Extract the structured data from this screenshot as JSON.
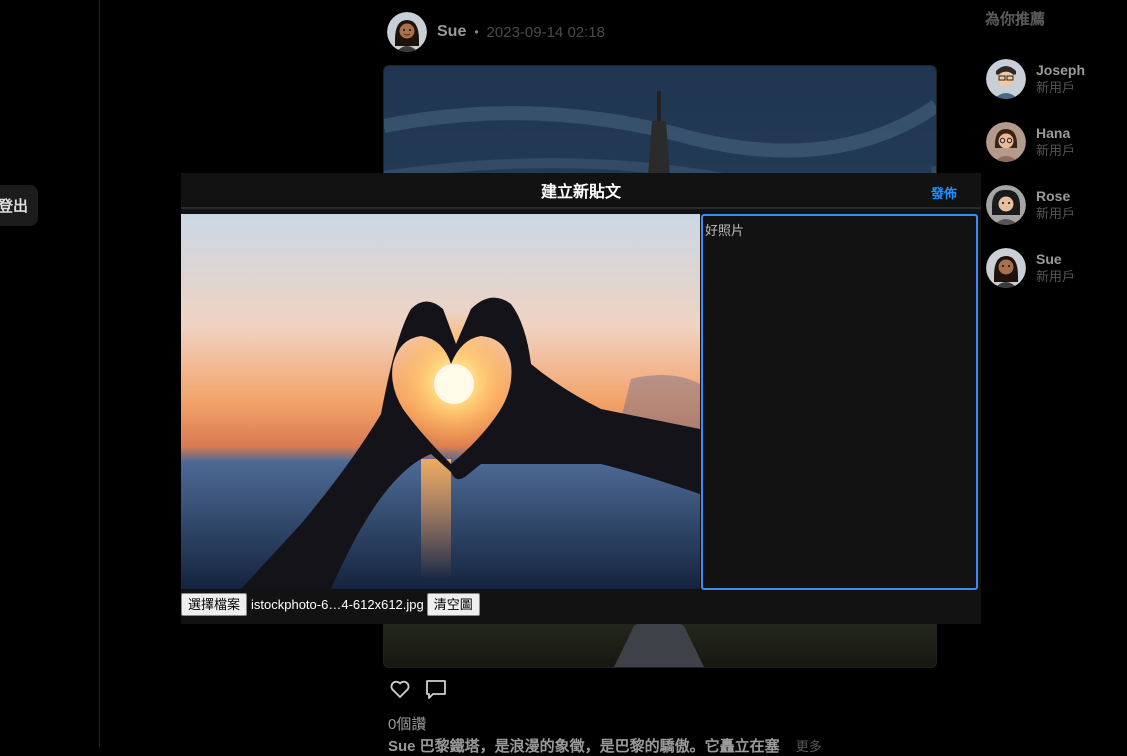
{
  "sidebar": {
    "logout_label": "登出"
  },
  "post": {
    "author": "Sue",
    "dot": "•",
    "time": "2023-09-14 02:18",
    "likes_text": "0個讚",
    "caption_text": "Sue 巴黎鐵塔，是浪漫的象徵，是巴黎的驕傲。它矗立在塞",
    "more_label": "更多"
  },
  "suggestions": {
    "title": "為你推薦",
    "items": [
      {
        "name": "Joseph",
        "subtitle": "新用戶",
        "skin": "#f1c9a5",
        "hair": "#2a2a2a",
        "shirt": "#4b6584"
      },
      {
        "name": "Hana",
        "subtitle": "新用戶",
        "skin": "#e8b996",
        "hair": "#3b2314",
        "shirt": "#8e6b5b"
      },
      {
        "name": "Rose",
        "subtitle": "新用戶",
        "skin": "#e8bfa0",
        "hair": "#1a1a1a",
        "shirt": "#555"
      },
      {
        "name": "Sue",
        "subtitle": "新用戶",
        "skin": "#a8704d",
        "hair": "#1e120b",
        "shirt": "#3a3a3a"
      }
    ]
  },
  "modal": {
    "title": "建立新貼文",
    "publish_label": "發佈",
    "caption_value": "好照片",
    "choose_file_label": "選擇檔案",
    "file_name": "istockphoto-6…4-612x612.jpg",
    "clear_label": "清空圖"
  },
  "colors": {
    "accent": "#1f8fff",
    "focus": "#3d8bf5",
    "modal_bg": "#121212"
  }
}
